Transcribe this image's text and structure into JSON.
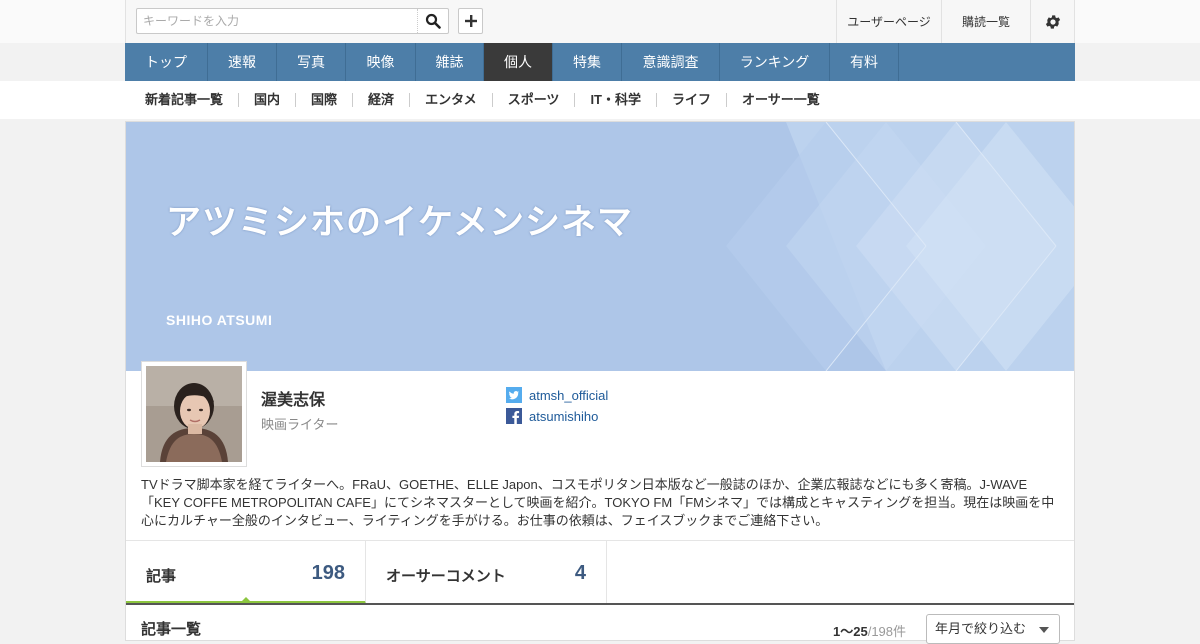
{
  "search": {
    "placeholder": "キーワードを入力"
  },
  "util": {
    "user_page": "ユーザーページ",
    "subscriptions": "購読一覧"
  },
  "nav": {
    "items": [
      "トップ",
      "速報",
      "写真",
      "映像",
      "雑誌",
      "個人",
      "特集",
      "意識調査",
      "ランキング",
      "有料"
    ],
    "active": "個人"
  },
  "subnav": {
    "items": [
      "新着記事一覧",
      "国内",
      "国際",
      "経済",
      "エンタメ",
      "スポーツ",
      "IT・科学",
      "ライフ",
      "オーサー一覧"
    ]
  },
  "banner": {
    "title": "アツミシホのイケメンシネマ",
    "subtitle": "SHIHO ATSUMI"
  },
  "author": {
    "name": "渥美志保",
    "role": "映画ライター",
    "twitter": "atmsh_official",
    "facebook": "atsumishiho",
    "bio": "TVドラマ脚本家を経てライターへ。FRaU、GOETHE、ELLE Japon、コスモポリタン日本版など一般誌のほか、企業広報誌などにも多く寄稿。J-WAVE「KEY COFFE METROPOLITAN CAFE」にてシネマスターとして映画を紹介。TOKYO FM「FMシネマ」では構成とキャスティングを担当。現在は映画を中心にカルチャー全般のインタビュー、ライティングを手がける。お仕事の依頼は、フェイスブックまでご連絡下さい。"
  },
  "tabs": {
    "articles": {
      "label": "記事",
      "count": "198"
    },
    "comments": {
      "label": "オーサーコメント",
      "count": "4"
    }
  },
  "list": {
    "title": "記事一覧",
    "range": "1～25",
    "total": "/198件",
    "filter": "年月で絞り込む"
  },
  "colors": {
    "nav": "#4d7ea8",
    "nav_active": "#3a3a3a",
    "banner": "#aec6e8",
    "accent": "#8cc63f",
    "link": "#1e5a99"
  }
}
